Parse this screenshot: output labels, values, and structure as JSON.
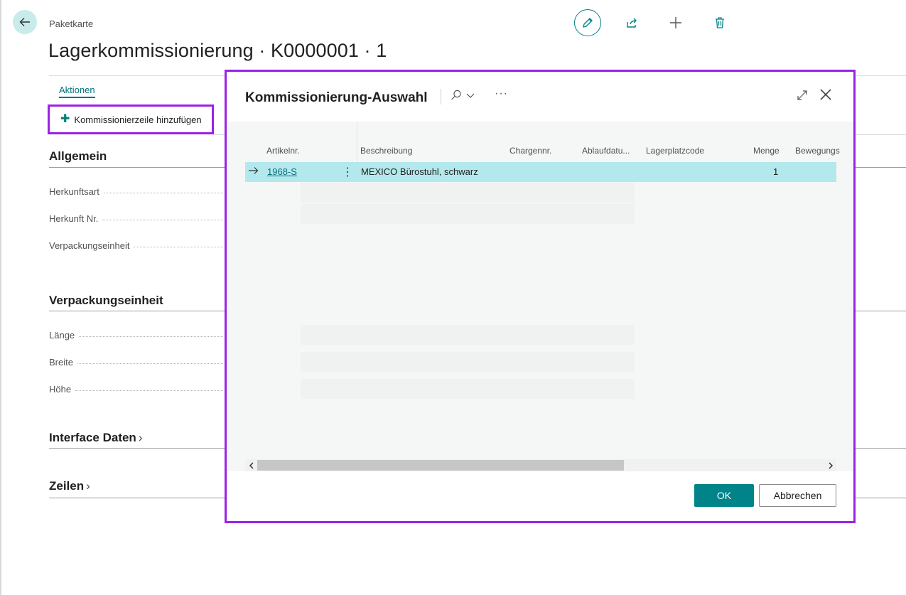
{
  "header": {
    "breadcrumb": "Paketkarte",
    "title": "Lagerkommissionierung · K0000001 · 1"
  },
  "toolbar": {
    "edit_icon": "pencil-icon",
    "share_icon": "share-icon",
    "new_icon": "plus-icon",
    "delete_icon": "trash-icon"
  },
  "actions": {
    "tab_label": "Aktionen",
    "add_line_label": "Kommissionierzeile hinzufügen"
  },
  "sections": {
    "general": {
      "title": "Allgemein",
      "fields": [
        "Herkunftsart",
        "Herkunft Nr.",
        "Verpackungseinheit"
      ]
    },
    "packaging": {
      "title": "Verpackungseinheit",
      "fields": [
        "Länge",
        "Breite",
        "Höhe"
      ]
    },
    "interface": {
      "title": "Interface Daten",
      "chevron": "›"
    },
    "lines": {
      "title": "Zeilen",
      "chevron": "›"
    }
  },
  "modal": {
    "title": "Kommissionierung-Auswahl",
    "more_label": "···",
    "columns": [
      "Artikelnr.",
      "Beschreibung",
      "Chargennr.",
      "Ablaufdatu...",
      "Lagerplatzcode",
      "Menge",
      "Bewegungs"
    ],
    "rows": [
      {
        "item_no": "1968-S",
        "description": "MEXICO Bürostuhl, schwarz",
        "lot_no": "",
        "expiry": "",
        "bin_code": "",
        "quantity": "1"
      }
    ],
    "ok_label": "OK",
    "cancel_label": "Abbrechen"
  },
  "colors": {
    "accent": "#008489",
    "highlight_border": "#9b21e8",
    "selected_row": "#b3e8ec"
  }
}
